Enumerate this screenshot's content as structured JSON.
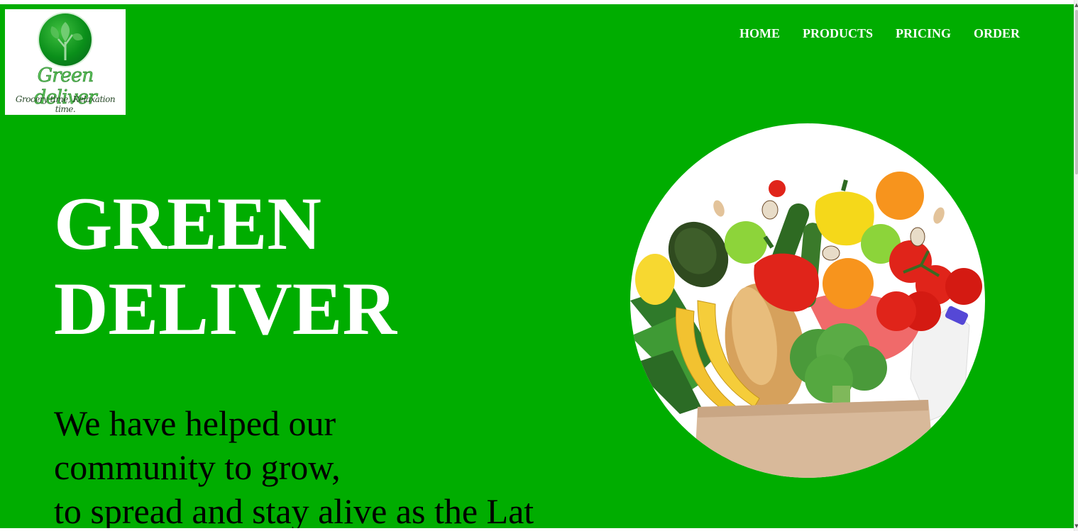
{
  "logo": {
    "name": "Green deliver",
    "tagline": "Grocery time, Relaxation time."
  },
  "nav": {
    "items": [
      "HOME",
      "PRODUCTS",
      "PRICING",
      "ORDER"
    ]
  },
  "hero": {
    "headline_line1": "GREEN",
    "headline_line2": "DELIVER",
    "body_line1": "We have helped our",
    "body_line2": "community to grow,",
    "body_line3": "to spread and stay alive as the Lat"
  },
  "colors": {
    "brand_green": "#00ad00",
    "text_white": "#ffffff",
    "text_black": "#000000"
  },
  "icons": {
    "logo_mark": "tree-leaf-icon",
    "hero_image": "grocery-bag-image"
  }
}
